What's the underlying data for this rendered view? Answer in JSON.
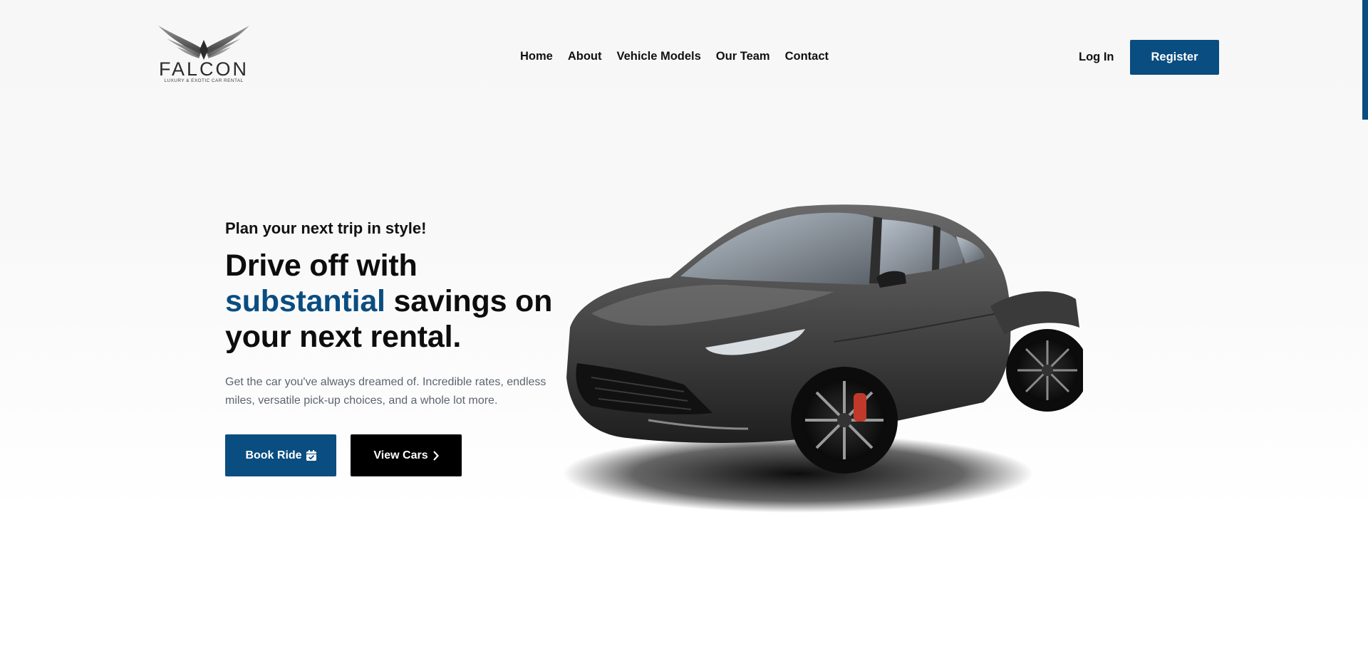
{
  "brand": {
    "name": "FALCON",
    "tagline": "LUXURY & EXOTIC CAR RENTAL"
  },
  "nav": {
    "items": [
      "Home",
      "About",
      "Vehicle Models",
      "Our Team",
      "Contact"
    ]
  },
  "auth": {
    "login_label": "Log In",
    "register_label": "Register"
  },
  "hero": {
    "kicker": "Plan your next trip in style!",
    "headline_part1": "Drive off with",
    "headline_accent": "substantial",
    "headline_part2": "savings on your next rental.",
    "description": "Get the car you've always dreamed of. Incredible rates, endless miles, versatile pick-up choices, and a whole lot more.",
    "book_label": "Book Ride",
    "view_label": "View Cars"
  },
  "icons": {
    "book": "calendar-check-icon",
    "view": "chevron-right-icon"
  },
  "colors": {
    "accent": "#0a4d80",
    "dark_button": "#000000",
    "text_muted": "#5d6470"
  }
}
